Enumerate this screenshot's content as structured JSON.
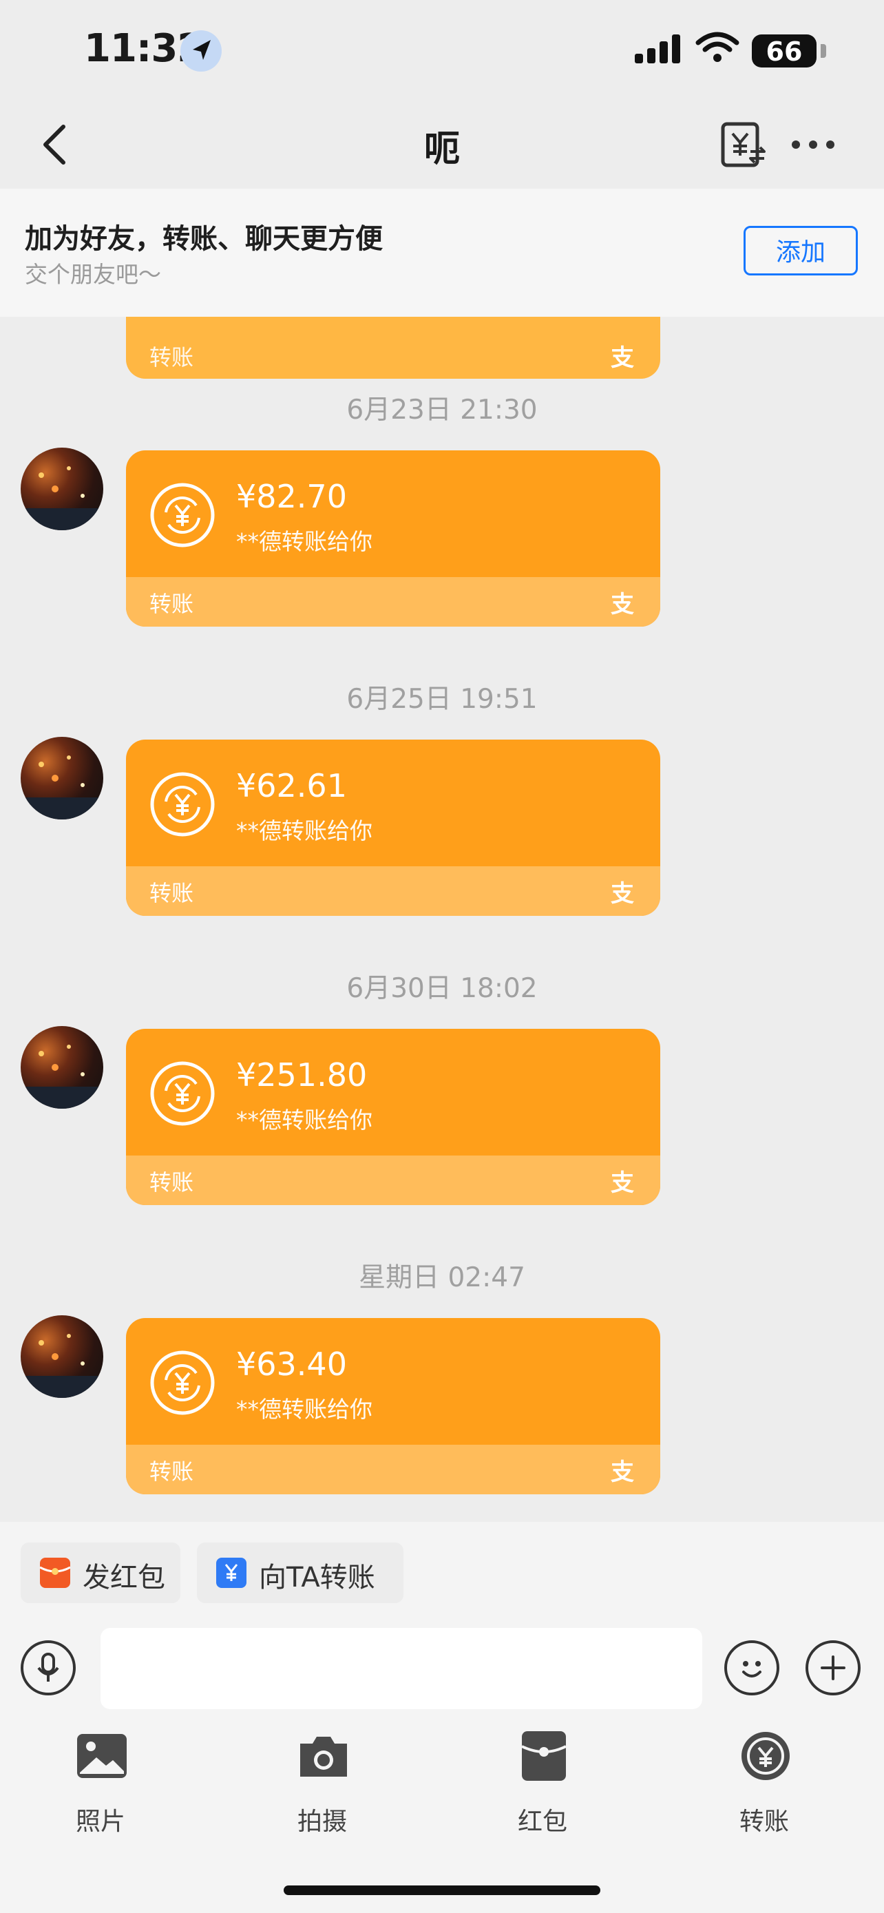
{
  "status_bar": {
    "time": "11:32",
    "battery": "66"
  },
  "nav": {
    "title": "呃"
  },
  "banner": {
    "title": "加为好友，转账、聊天更方便",
    "subtitle": "交个朋友吧～",
    "add_button": "添加"
  },
  "partial_card": {
    "footer_label": "转账",
    "logo": "支"
  },
  "messages": [
    {
      "timestamp": "6月23日 21:30",
      "amount": "¥82.70",
      "description": "**德转账给你",
      "footer_label": "转账",
      "logo": "支"
    },
    {
      "timestamp": "6月25日 19:51",
      "amount": "¥62.61",
      "description": "**德转账给你",
      "footer_label": "转账",
      "logo": "支"
    },
    {
      "timestamp": "6月30日 18:02",
      "amount": "¥251.80",
      "description": "**德转账给你",
      "footer_label": "转账",
      "logo": "支"
    },
    {
      "timestamp": "星期日 02:47",
      "amount": "¥63.40",
      "description": "**德转账给你",
      "footer_label": "转账",
      "logo": "支"
    }
  ],
  "quick_actions": {
    "red_packet": "发红包",
    "transfer": "向TA转账"
  },
  "input": {
    "placeholder": ""
  },
  "tools": [
    {
      "label": "照片",
      "icon": "photo-icon"
    },
    {
      "label": "拍摄",
      "icon": "camera-icon"
    },
    {
      "label": "红包",
      "icon": "red-packet-icon"
    },
    {
      "label": "转账",
      "icon": "transfer-icon"
    }
  ],
  "colors": {
    "card": "#ff9f1a",
    "card_footer": "#ffbc5a",
    "link_blue": "#1677ff",
    "red_packet": "#f25a24",
    "transfer_blue": "#2f7bf5"
  }
}
